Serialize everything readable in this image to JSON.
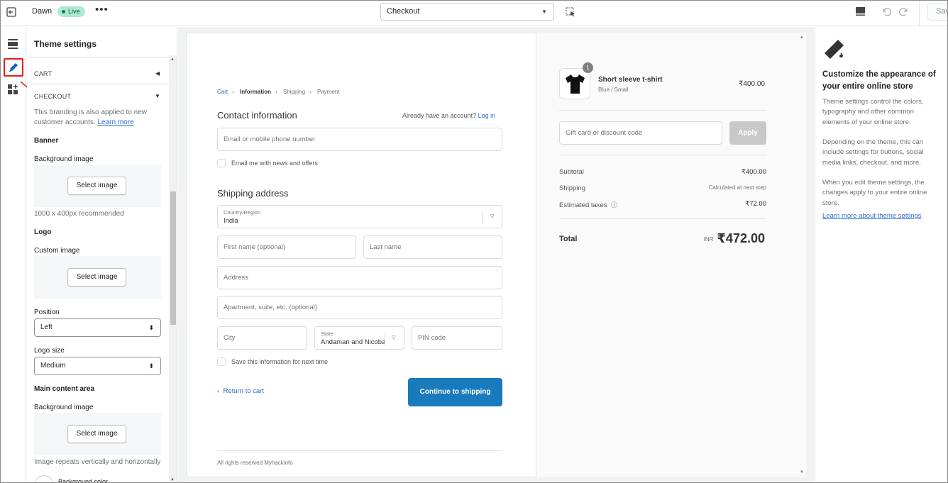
{
  "topbar": {
    "store_name": "Dawn",
    "live_badge": "Live",
    "more": "•••",
    "page_select": "Checkout",
    "save_label": "Save"
  },
  "panel": {
    "title": "Theme settings",
    "cart_header": "CART",
    "checkout_header": "CHECKOUT",
    "branding_note": "This branding is also applied to new customer accounts.",
    "learn_more": "Learn more",
    "banner": "Banner",
    "banner_bg_label": "Background image",
    "select_image": "Select image",
    "banner_hint": "1000 x 400px recommended",
    "logo": "Logo",
    "custom_image": "Custom image",
    "position_label": "Position",
    "position_value": "Left",
    "logo_size_label": "Logo size",
    "logo_size_value": "Medium",
    "main_content": "Main content area",
    "main_bg_label": "Background image",
    "repeat_note": "Image repeats vertically and horizontally",
    "bg_color": "Background color"
  },
  "checkout": {
    "breadcrumb": [
      "Cart",
      "Information",
      "Shipping",
      "Payment"
    ],
    "contact_title": "Contact information",
    "have_account": "Already have an account?",
    "login": "Log in",
    "email_placeholder": "Email or mobile phone number",
    "email_offers": "Email me with news and offers",
    "shipping_title": "Shipping address",
    "country_label": "Country/Region",
    "country_value": "India",
    "first_name": "First name (optional)",
    "last_name": "Last name",
    "address": "Address",
    "apartment": "Apartment, suite, etc. (optional)",
    "city": "City",
    "state_label": "State",
    "state_value": "Andaman and Nicobar Islands",
    "pin": "PIN code",
    "save_info": "Save this information for next time",
    "return_cart": "Return to cart",
    "continue": "Continue to shipping",
    "footer": "All rights reserved Myhackinfo"
  },
  "summary": {
    "product_name": "Short sleeve t-shirt",
    "product_variant": "Blue / Small",
    "product_price": "₹400.00",
    "quantity": "1",
    "gift_placeholder": "Gift card or discount code",
    "apply": "Apply",
    "subtotal_label": "Subtotal",
    "subtotal_value": "₹400.00",
    "shipping_label": "Shipping",
    "shipping_value": "Calculated at next step",
    "taxes_label": "Estimated taxes",
    "taxes_value": "₹72.00",
    "total_label": "Total",
    "currency": "INR",
    "total_value": "₹472.00"
  },
  "info": {
    "title": "Customize the appearance of your entire online store",
    "p1": "Theme settings control the colors, typography and other common elements of your online store.",
    "p2": "Depending on the theme, this can include settings for buttons, social media links, checkout, and more.",
    "p3": "When you edit theme settings, the changes apply to your entire online store.",
    "link": "Learn more about theme settings"
  },
  "colors": {
    "accent_blue": "#2c6ecb",
    "continue_button": "#197bbd",
    "live_green": "#aee9d1",
    "highlight_red": "#e02020"
  }
}
